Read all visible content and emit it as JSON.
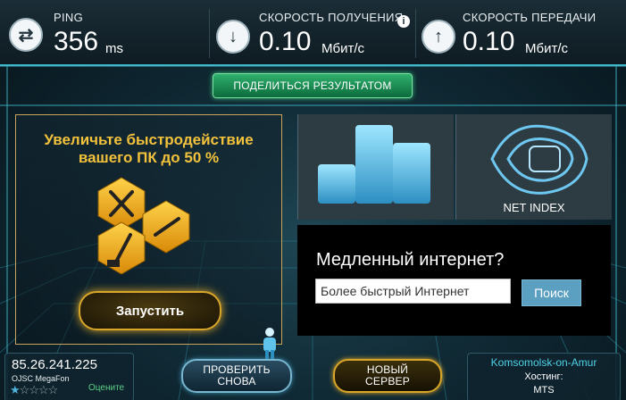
{
  "metrics": {
    "ping": {
      "label": "PING",
      "value": "356",
      "unit": "ms",
      "icon": "transfer-arrows-icon"
    },
    "download": {
      "label": "СКОРОСТЬ ПОЛУЧЕНИЯ",
      "value": "0.10",
      "unit": "Мбит/с",
      "icon": "download-arrow-icon"
    },
    "upload": {
      "label": "СКОРОСТЬ ПЕРЕДАЧИ",
      "value": "0.10",
      "unit": "Мбит/с",
      "icon": "upload-arrow-icon"
    },
    "info_glyph": "i"
  },
  "share_label": "ПОДЕЛИТЬСЯ РЕЗУЛЬТАТОМ",
  "ad": {
    "title_line1": "Увеличьте быстродействие",
    "title_line2": "вашего ПК до 50 %",
    "button": "Запустить"
  },
  "net_index_label": "NET INDEX",
  "search": {
    "title": "Медленный интернет?",
    "input_value": "Более быстрый Интернет",
    "button": "Поиск"
  },
  "client": {
    "ip": "85.26.241.225",
    "isp": "OJSC MegaFon",
    "rate_label": "Оцените",
    "rating": 1,
    "max_rating": 5
  },
  "buttons": {
    "retest_line1": "ПРОВЕРИТЬ",
    "retest_line2": "СНОВА",
    "new_server_line1": "НОВЫЙ",
    "new_server_line2": "СЕРВЕР"
  },
  "host": {
    "city": "Komsomolsk-on-Amur",
    "label": "Хостинг:",
    "name": "MTS"
  },
  "colors": {
    "accent": "#3fb7c9",
    "gold": "#d9a629",
    "share_green": "#2fb06d"
  }
}
